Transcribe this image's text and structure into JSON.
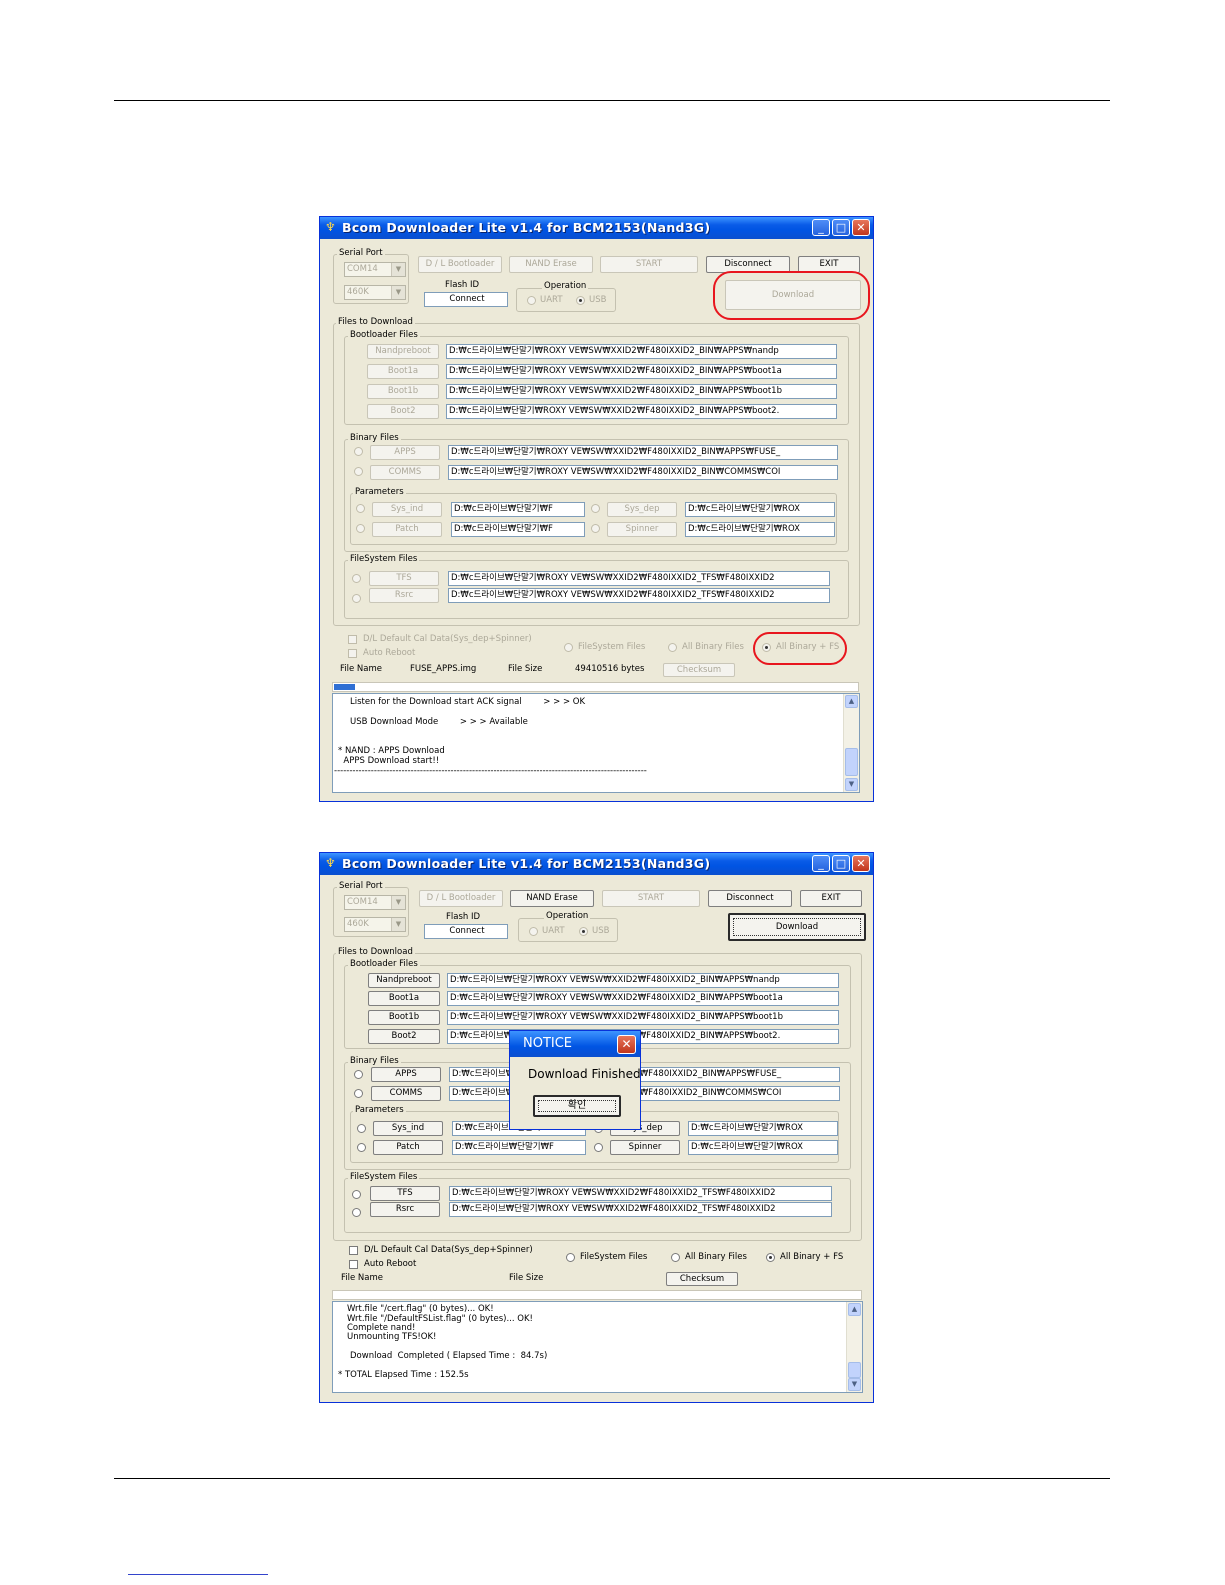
{
  "page": {},
  "title": "Bcom Downloader Lite v1.4 for BCM2153(Nand3G)",
  "labels": {
    "serial_port": "Serial Port",
    "flash_id": "Flash ID",
    "operation": "Operation",
    "uart": "UART",
    "usb": "USB",
    "files_to_download": "Files to Download",
    "bootloader_files": "Bootloader Files",
    "binary_files": "Binary Files",
    "parameters": "Parameters",
    "filesystem_files": "FileSystem Files",
    "dl_default_cal": "D/L Default Cal Data(Sys_dep+Spinner)",
    "auto_reboot": "Auto Reboot",
    "opt_filesystem": "FileSystem Files",
    "opt_all_binary": "All Binary Files",
    "opt_all_binary_fs": "All Binary + FS",
    "file_name": "File Name",
    "file_size": "File Size"
  },
  "buttons": {
    "dl_bootloader": "D / L Bootloader",
    "nand_erase": "NAND Erase",
    "start": "START",
    "disconnect": "Disconnect",
    "exit": "EXIT",
    "download": "Download",
    "checksum": "Checksum",
    "nandpreboot": "Nandpreboot",
    "boot1a": "Boot1a",
    "boot1b": "Boot1b",
    "boot2": "Boot2",
    "apps": "APPS",
    "comms": "COMMS",
    "sys_ind": "Sys_ind",
    "sys_dep": "Sys_dep",
    "patch": "Patch",
    "spinner": "Spinner",
    "tfs": "TFS",
    "rsrc": "Rsrc"
  },
  "values": {
    "com_port": "COM14",
    "baud": "460K",
    "connect": "Connect"
  },
  "paths": {
    "nandpreboot": "D:₩c드라이브₩단말기₩ROXY VE₩SW₩XXID2₩F480IXXID2_BIN₩APPS₩nandp",
    "boot1a": "D:₩c드라이브₩단말기₩ROXY VE₩SW₩XXID2₩F480IXXID2_BIN₩APPS₩boot1a",
    "boot1b": "D:₩c드라이브₩단말기₩ROXY VE₩SW₩XXID2₩F480IXXID2_BIN₩APPS₩boot1b",
    "boot2": "D:₩c드라이브₩단말기₩ROXY VE₩SW₩XXID2₩F480IXXID2_BIN₩APPS₩boot2.",
    "apps": "D:₩c드라이브₩단말기₩ROXY VE₩SW₩XXID2₩F480IXXID2_BIN₩APPS₩FUSE_",
    "comms": "D:₩c드라이브₩단말기₩ROXY VE₩SW₩XXID2₩F480IXXID2_BIN₩COMMS₩COI",
    "sys_ind": "D:₩c드라이브₩단말기₩F",
    "patch": "D:₩c드라이브₩단말기₩F",
    "sys_dep": "D:₩c드라이브₩단말기₩ROX",
    "spinner": "D:₩c드라이브₩단말기₩ROX",
    "tfs": "D:₩c드라이브₩단말기₩ROXY VE₩SW₩XXID2₩F480IXXID2_TFS₩F480IXXID2",
    "rsrc": "D:₩c드라이브₩단말기₩ROXY VE₩SW₩XXID2₩F480IXXID2_TFS₩F480IXXID2"
  },
  "window1": {
    "file_name_value": "FUSE_APPS.img",
    "file_size_value": "49410516 bytes",
    "progress_fraction": 0.04,
    "log": [
      "Listen for the Download start ACK signal        > > > OK",
      "USB Download Mode        > > > Available",
      "* NAND : APPS Download",
      "  APPS Download start!!",
      "------------------------------------------------------------------------------------------------------"
    ]
  },
  "window2": {
    "log": [
      "Wrt.file \"/cert.flag\" (0 bytes)... OK!",
      "Wrt.file \"/DefaultFSList.flag\" (0 bytes)... OK!",
      "Complete nand!",
      "Unmounting TFS!OK!",
      "Download  Completed ( Elapsed Time :  84.7s)",
      "* TOTAL Elapsed Time : 152.5s"
    ]
  },
  "notice": {
    "title": "NOTICE",
    "message": "Download Finished",
    "ok": "확인"
  },
  "colors": {
    "titlebar": "#0054e3",
    "highlight": "#e8161e",
    "progress": "#2f6fd4"
  }
}
